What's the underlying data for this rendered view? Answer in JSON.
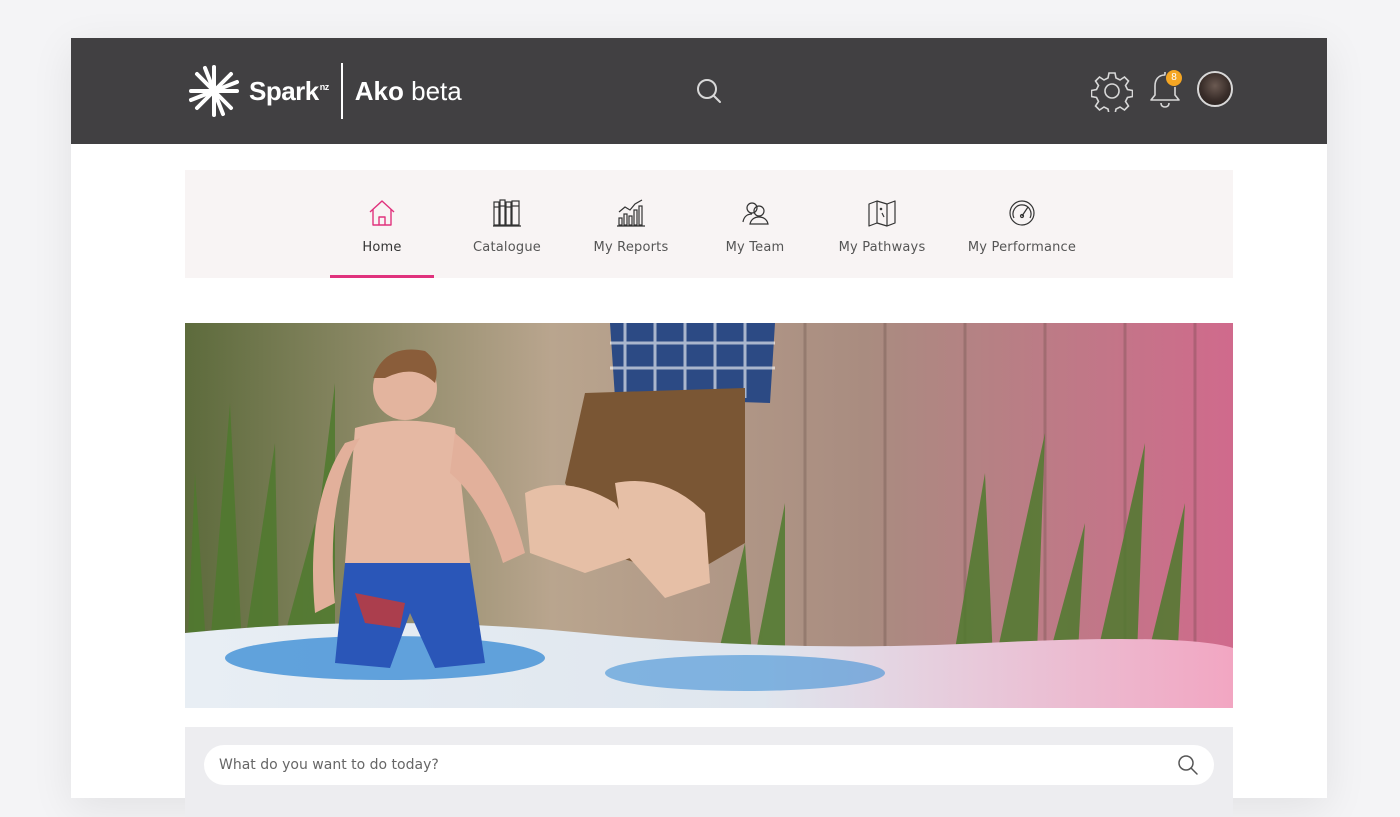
{
  "header": {
    "brand": "Spark",
    "brand_suffix": "nz",
    "app_name_bold": "Ako",
    "app_name_rest": " beta",
    "notifications_count": "8",
    "colors": {
      "bar": "#414042",
      "badge": "#f5a623"
    }
  },
  "nav": {
    "items": [
      {
        "label": "Home",
        "icon": "home-icon",
        "active": true
      },
      {
        "label": "Catalogue",
        "icon": "books-icon",
        "active": false
      },
      {
        "label": "My Reports",
        "icon": "chart-icon",
        "active": false
      },
      {
        "label": "My Team",
        "icon": "team-icon",
        "active": false
      },
      {
        "label": "My Pathways",
        "icon": "map-icon",
        "active": false
      },
      {
        "label": "My Performance",
        "icon": "gauge-icon",
        "active": false
      }
    ],
    "accent": "#e0327d"
  },
  "hero": {
    "image": "hero-image"
  },
  "search": {
    "placeholder": "What do you want to do today?"
  }
}
